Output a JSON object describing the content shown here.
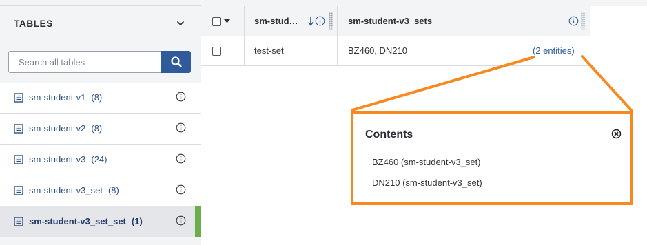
{
  "sidebar": {
    "title": "TABLES",
    "search": {
      "placeholder": "Search all tables",
      "value": ""
    },
    "items": [
      {
        "label": "sm-student-v1",
        "count": "(8)"
      },
      {
        "label": "sm-student-v2",
        "count": "(8)"
      },
      {
        "label": "sm-student-v3",
        "count": "(24)"
      },
      {
        "label": "sm-student-v3_set",
        "count": "(8)"
      },
      {
        "label": "sm-student-v3_set_set",
        "count": "(1)",
        "active": true
      }
    ]
  },
  "table": {
    "columns": [
      "sm-stud…",
      "sm-student-v3_sets"
    ],
    "rows": [
      {
        "name": "test-set",
        "sets": "BZ460,  DN210",
        "link": "(2 entities)"
      }
    ]
  },
  "popup": {
    "title": "Contents",
    "items": [
      "BZ460 (sm-student-v3_set)",
      "DN210 (sm-student-v3_set)"
    ]
  },
  "colors": {
    "accent_blue": "#2f5b9a",
    "active_green": "#6cae4a",
    "callout_orange": "#f7891f"
  },
  "icons": [
    "chevron-down-icon",
    "search-icon",
    "table-icon",
    "info-icon",
    "sort-down-arrow-icon",
    "column-grip-icon",
    "close-circle-icon"
  ]
}
